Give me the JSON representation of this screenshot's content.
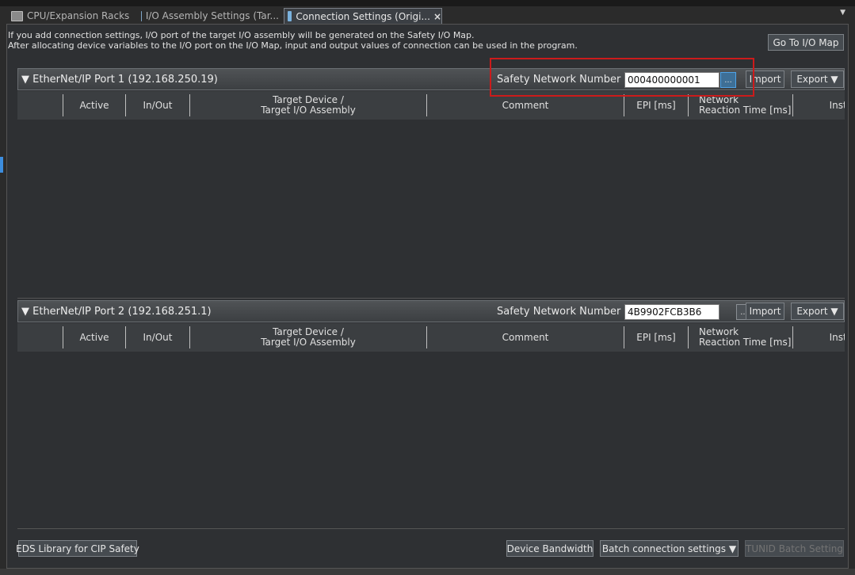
{
  "tabs": [
    {
      "label": "CPU/Expansion Racks"
    },
    {
      "label": "I/O Assembly Settings (Tar..."
    },
    {
      "label": "Connection Settings (Origi...",
      "close": "×"
    }
  ],
  "info": {
    "line1": "If you add connection settings, I/O port of the target I/O assembly will be generated on the Safety I/O Map.",
    "line2": "After allocating device variables to the I/O port on the I/O Map, input and output values of connection can be used in the program."
  },
  "goto_io_map": "Go To I/O Map",
  "ports": [
    {
      "title": "▼ EtherNet/IP Port 1 (192.168.250.19)",
      "snn_label": "Safety Network Number :",
      "snn_value": "000400000001",
      "dots": "...",
      "import": "Import",
      "export": "Export ▼"
    },
    {
      "title": "▼ EtherNet/IP Port 2 (192.168.251.1)",
      "snn_label": "Safety Network Number :",
      "snn_value": "4B9902FCB3B6",
      "dots": "...",
      "import": "Import",
      "export": "Export ▼"
    }
  ],
  "columns": {
    "active": "Active",
    "inout": "In/Out",
    "target1": "Target Device /",
    "target2": "Target I/O Assembly",
    "comment": "Comment",
    "epi": "EPI [ms]",
    "nrt1": "Network",
    "nrt2": "Reaction Time [ms]",
    "instance": "Instar"
  },
  "footer": {
    "eds": "EDS Library for CIP Safety",
    "bandwidth": "Device Bandwidth",
    "batch": "Batch connection settings ▼",
    "tunid": "TUNID Batch Setting"
  },
  "colors": {
    "highlight": "#cc1b1b",
    "accent": "#3c8dde"
  }
}
